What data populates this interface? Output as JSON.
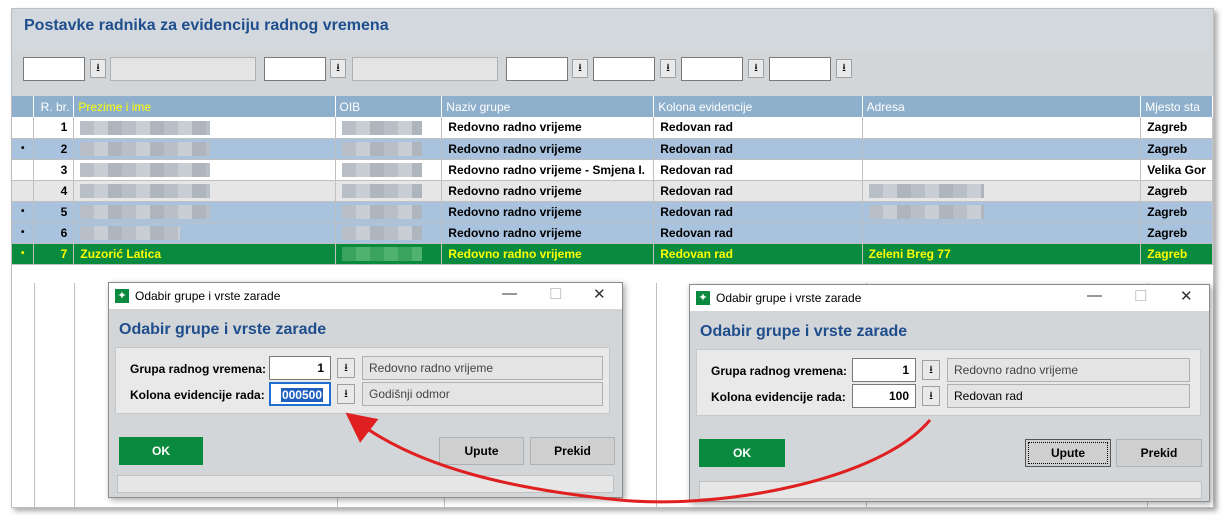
{
  "page_title": "Postavke radnika za evidenciju radnog vremena",
  "filter_icon": "download-arrow-icon",
  "table": {
    "headers": [
      "R. br.",
      "Prezime i ime",
      "OIB",
      "Naziv grupe",
      "Kolona evidencije",
      "Adresa",
      "Mjesto sta"
    ],
    "rows": [
      {
        "no": "1",
        "name": "",
        "group": "Redovno radno vrijeme",
        "column": "Redovan rad",
        "address": "",
        "place": "Zagreb",
        "dot": ""
      },
      {
        "no": "2",
        "name": "",
        "group": "Redovno radno vrijeme",
        "column": "Redovan rad",
        "address": "",
        "place": "Zagreb",
        "dot": "•"
      },
      {
        "no": "3",
        "name": "",
        "group": "Redovno radno vrijeme - Smjena I.",
        "column": "Redovan rad",
        "address": "",
        "place": "Velika Gor",
        "dot": ""
      },
      {
        "no": "4",
        "name": "",
        "group": "Redovno radno vrijeme",
        "column": "Redovan rad",
        "address": "",
        "place": "Zagreb",
        "dot": ""
      },
      {
        "no": "5",
        "name": "",
        "group": "Redovno radno vrijeme",
        "column": "Redovan rad",
        "address": "",
        "place": "Zagreb",
        "dot": "•"
      },
      {
        "no": "6",
        "name": "",
        "group": "Redovno radno vrijeme",
        "column": "Redovan rad",
        "address": "",
        "place": "Zagreb",
        "dot": "•"
      },
      {
        "no": "7",
        "name": "Zuzorić Latica",
        "group": "Redovno radno vrijeme",
        "column": "Redovan rad",
        "address": "Zeleni Breg 77",
        "place": "Zagreb",
        "dot": "•"
      }
    ]
  },
  "dialog_left": {
    "caption": "Odabir grupe i vrste zarade",
    "heading": "Odabir grupe i vrste zarade",
    "group_label": "Grupa radnog vremena:",
    "group_value": "1",
    "group_desc": "Redovno radno vrijeme",
    "column_label": "Kolona evidencije rada:",
    "column_value": "000500",
    "column_desc": "Godišnji odmor",
    "ok": "OK",
    "help": "Upute",
    "cancel": "Prekid"
  },
  "dialog_right": {
    "caption": "Odabir grupe i vrste zarade",
    "heading": "Odabir grupe i vrste zarade",
    "group_label": "Grupa radnog vremena:",
    "group_value": "1",
    "group_desc": "Redovno radno vrijeme",
    "column_label": "Kolona evidencije rada:",
    "column_value": "100",
    "column_desc": "Redovan rad",
    "ok": "OK",
    "help": "Upute",
    "cancel": "Prekid"
  },
  "window_buttons": {
    "minimize": "—",
    "maximize": "☐",
    "close": "✕"
  },
  "arrow_color": "#e02020",
  "accent_green": "#0a8a3e",
  "header_blue": "#1f4e8c"
}
